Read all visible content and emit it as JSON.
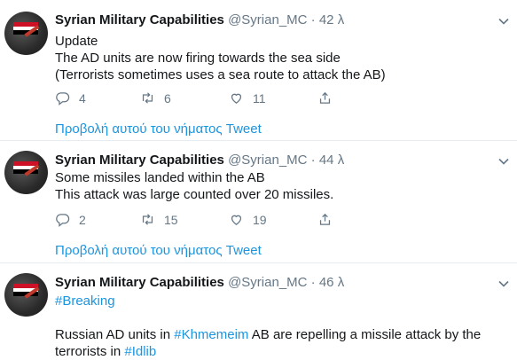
{
  "tweets": [
    {
      "name": "Syrian Military Capabilities",
      "handle": "@Syrian_MC",
      "separator": "·",
      "time": "42 λ",
      "lines": [
        "Update",
        "The AD units are now firing towards the sea side",
        "(Terrorists sometimes uses a sea route to attack the AB)"
      ],
      "replies": "4",
      "retweets": "6",
      "likes": "11",
      "thread_link": "Προβολή αυτού του νήματος Tweet"
    },
    {
      "name": "Syrian Military Capabilities",
      "handle": "@Syrian_MC",
      "separator": "·",
      "time": "44 λ",
      "lines": [
        "Some missiles landed within the AB",
        "This attack was large counted over 20 missiles."
      ],
      "replies": "2",
      "retweets": "15",
      "likes": "19",
      "thread_link": "Προβολή αυτού του νήματος Tweet"
    },
    {
      "name": "Syrian Military Capabilities",
      "handle": "@Syrian_MC",
      "separator": "·",
      "time": "46 λ",
      "hashtag_line": "#Breaking",
      "line2_pre": "Russian AD units in ",
      "line2_tag": "#Khmemeim",
      "line2_post": " AB are repelling a missile attack by the",
      "line3_pre": "terrorists in ",
      "line3_tag": "#Idlib"
    }
  ],
  "colors": {
    "accent": "#1b95e0",
    "muted": "#657786",
    "text": "#14171a",
    "divider": "#e6ecf0"
  },
  "icons": [
    "chevron-down-icon",
    "reply-icon",
    "retweet-icon",
    "like-icon",
    "share-icon"
  ]
}
